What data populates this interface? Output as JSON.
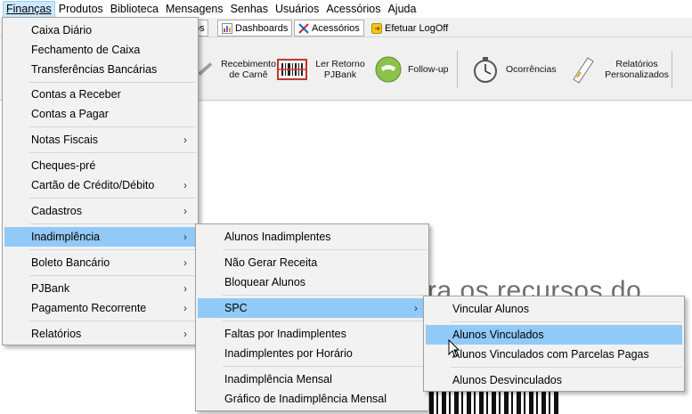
{
  "menubar": {
    "items": [
      "Finanças",
      "Produtos",
      "Biblioteca",
      "Mensagens",
      "Senhas",
      "Usuários",
      "Acessórios",
      "Ajuda"
    ]
  },
  "tabs": {
    "partial": "os",
    "dashboards": "Dashboards",
    "acessorios": "Acessórios",
    "logoff": "Efetuar LogOff"
  },
  "toolbar": {
    "recebimento": "Recebimento de Carnê",
    "retorno": "Ler Retorno PJBank",
    "followup": "Follow-up",
    "ocorrencias": "Ocorrências",
    "relatorios": "Relatórios Personalizados"
  },
  "main": {
    "bigtext": "ra os recursos do"
  },
  "menu_financas": {
    "items": [
      "Caixa Diário",
      "Fechamento de Caixa",
      "Transferências Bancárias",
      "Contas a Receber",
      "Contas a Pagar",
      "Notas Fiscais",
      "Cheques-pré",
      "Cartão de Crédito/Débito",
      "Cadastros",
      "Inadimplência",
      "Boleto Bancário",
      "PJBank",
      "Pagamento Recorrente",
      "Relatórios"
    ]
  },
  "menu_inadimplencia": {
    "items": [
      "Alunos Inadimplentes",
      "Não Gerar Receita",
      "Bloquear Alunos",
      "SPC",
      "Faltas por Inadimplentes",
      "Inadimplentes por Horário",
      "Inadimplência Mensal",
      "Gráfico de Inadimplência Mensal"
    ]
  },
  "menu_spc": {
    "items": [
      "Vincular Alunos",
      "Alunos Vinculados",
      "Alunos Vinculados com Parcelas Pagas",
      "Alunos Desvinculados"
    ]
  },
  "arrow_glyph": "›",
  "colors": {
    "highlight": "#91c9f7",
    "menubar_active": "#cce8ff"
  }
}
